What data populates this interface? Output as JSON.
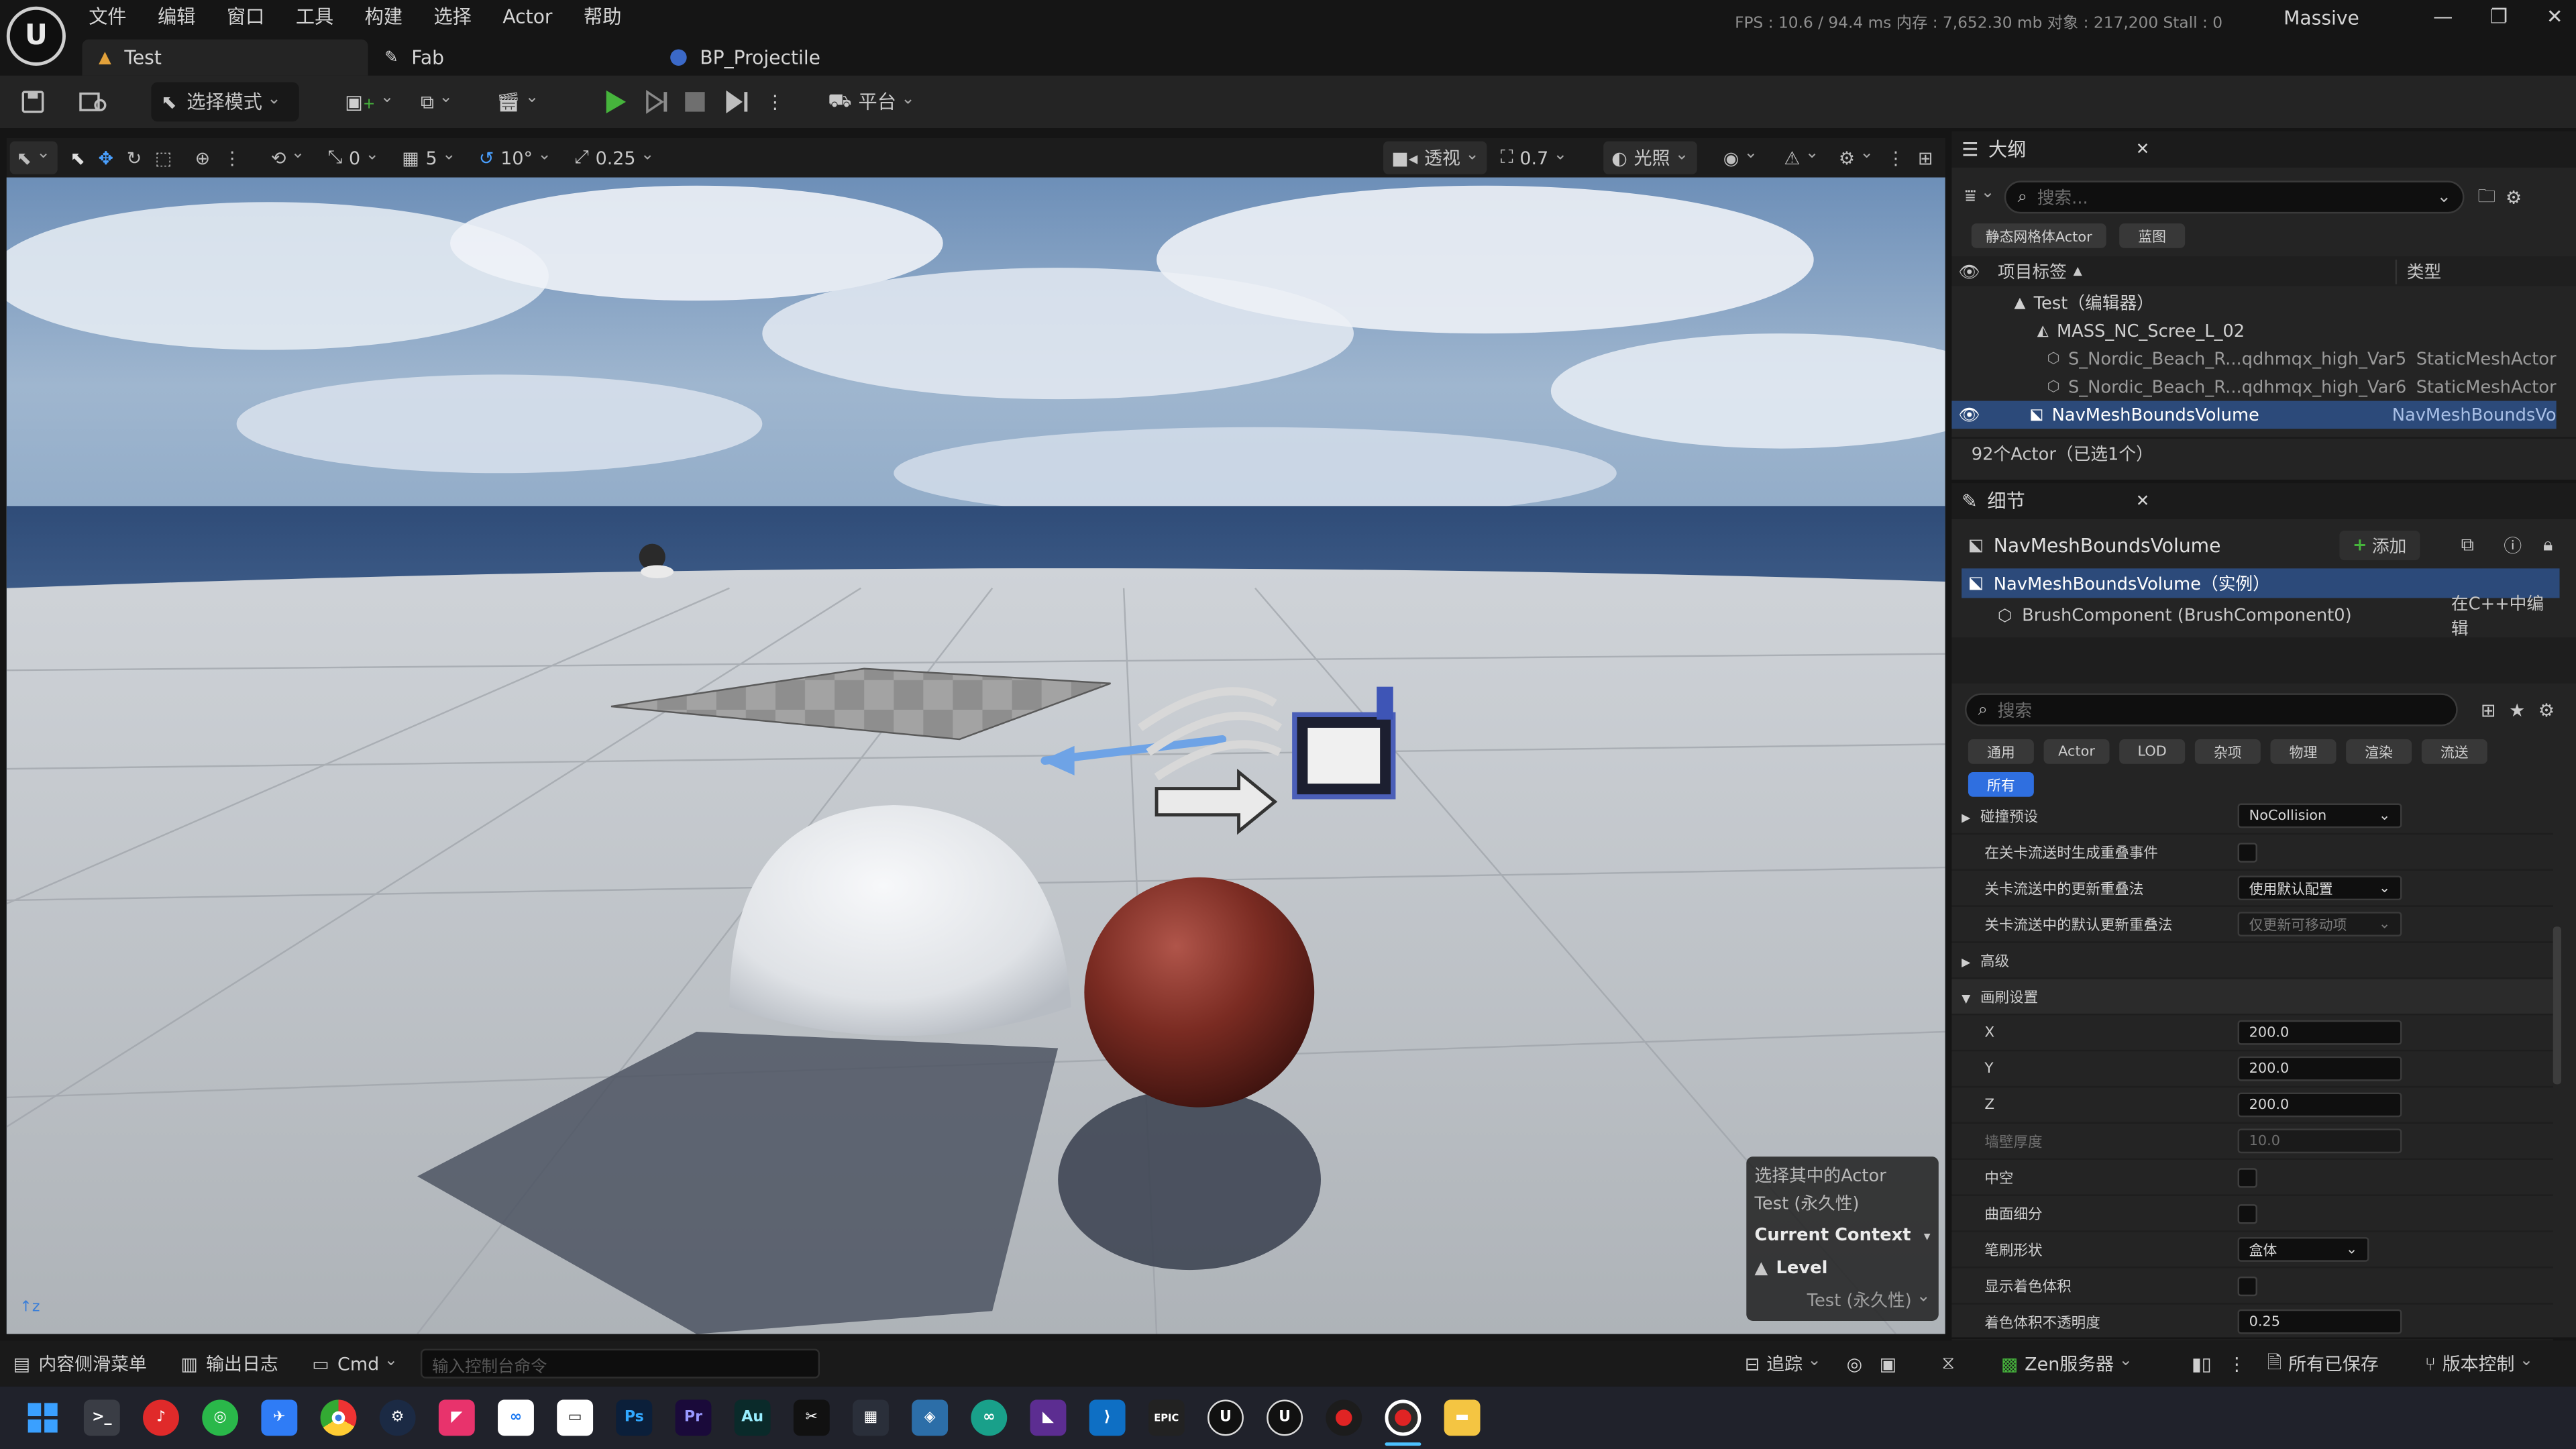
{
  "menu": [
    "文件",
    "编辑",
    "窗口",
    "工具",
    "构建",
    "选择",
    "Actor",
    "帮助"
  ],
  "stats": "FPS : 10.6  /  94.4 ms    内存 : 7,652.30 mb   对象 : 217,200   Stall : 0",
  "project_name": "Massive",
  "doc_tabs": [
    "Test",
    "Fab",
    "BP_Projectile"
  ],
  "toolbar": {
    "mode": "选择模式",
    "platform": "平台"
  },
  "viewport_toolbar": {
    "rotate_snap": "0",
    "grid_snap": "5",
    "angle_snap": "10°",
    "scale_snap": "0.25",
    "view_mode": "透视",
    "camera_speed": "0.7",
    "lighting": "光照"
  },
  "context_panel": {
    "line1": "选择其中的Actor",
    "line2": "Test (永久性)",
    "current_context": "Current Context",
    "level": "Level",
    "level_value": "Test (永久性)"
  },
  "outliner": {
    "tab": "大纲",
    "search_placeholder": "搜索...",
    "filters": [
      "静态网格体Actor",
      "蓝图"
    ],
    "col_label": "项目标签",
    "col_type": "类型",
    "rows": [
      {
        "label": "Test（编辑器）",
        "type": ""
      },
      {
        "label": "MASS_NC_Scree_L_02",
        "type": ""
      },
      {
        "label": "S_Nordic_Beach_R...qdhmqx_high_Var5",
        "type": "StaticMeshActor"
      },
      {
        "label": "S_Nordic_Beach_R...qdhmqx_high_Var6",
        "type": "StaticMeshActor"
      },
      {
        "label": "NavMeshBoundsVolume",
        "type": "NavMeshBoundsVo"
      }
    ],
    "footer": "92个Actor（已选1个）"
  },
  "details": {
    "tab": "细节",
    "object_name": "NavMeshBoundsVolume",
    "add_label": "添加",
    "instance_label": "NavMeshBoundsVolume（实例）",
    "component_label": "BrushComponent (BrushComponent0)",
    "edit_in_cpp": "在C++中编辑",
    "search_placeholder": "搜索",
    "category_tabs": [
      "通用",
      "Actor",
      "LOD",
      "杂项",
      "物理",
      "渲染",
      "流送"
    ],
    "all_tab": "所有",
    "props": {
      "collision_preset": "碰撞预设",
      "collision_value": "NoCollision",
      "gen_overlap": "在关卡流送时生成重叠事件",
      "update_overlap": "关卡流送中的更新重叠法",
      "update_overlap_value": "使用默认配置",
      "default_update_overlap": "关卡流送中的默认更新重叠法",
      "default_update_overlap_value": "仅更新可移动项",
      "advanced": "高级",
      "brush_settings": "画刷设置",
      "x_label": "X",
      "x_value": "200.0",
      "y_label": "Y",
      "y_value": "200.0",
      "z_label": "Z",
      "z_value": "200.0",
      "wall_thickness": "墙壁厚度",
      "wall_value": "10.0",
      "hollow": "中空",
      "tessellated": "曲面细分",
      "brush_shape": "笔刷形状",
      "brush_shape_value": "盒体",
      "show_shaded": "显示着色体积",
      "shaded_opacity": "着色体积不透明度",
      "shaded_opacity_value": "0.25"
    }
  },
  "statusbar": {
    "content_drawer": "内容侧滑菜单",
    "output_log": "输出日志",
    "cmd": "Cmd",
    "console_placeholder": "输入控制台命令",
    "trace": "追踪",
    "zen": "Zen服务器",
    "saved": "所有已保存",
    "source_control": "版本控制"
  },
  "taskbar_apps": [
    "windows",
    "terminal",
    "netease-music",
    "wechat",
    "feishu",
    "chrome",
    "steam",
    "app-red",
    "meta",
    "app-white",
    "photoshop",
    "premiere",
    "audition",
    "capcut",
    "calculator",
    "app-map",
    "app-green",
    "visual-studio",
    "vscode",
    "epic-games",
    "unreal-1",
    "unreal-2",
    "obs",
    "recorder",
    "file-explorer"
  ],
  "colors": {
    "accent": "#2f6fe0",
    "play": "#46b43c",
    "selection": "#2c4a7a"
  }
}
